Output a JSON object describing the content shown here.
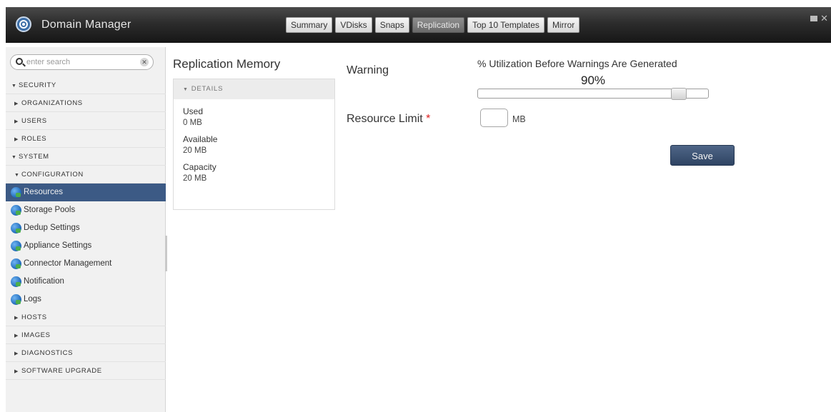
{
  "app": {
    "title": "Domain Manager",
    "tabs": [
      {
        "label": "Summary",
        "active": false
      },
      {
        "label": "VDisks",
        "active": false
      },
      {
        "label": "Snaps",
        "active": false
      },
      {
        "label": "Replication",
        "active": true
      },
      {
        "label": "Top 10 Templates",
        "active": false
      },
      {
        "label": "Mirror",
        "active": false
      }
    ],
    "window_controls": {
      "close": "✕"
    }
  },
  "sidebar": {
    "search": {
      "placeholder": "enter search",
      "value": ""
    },
    "nav": [
      {
        "type": "group",
        "label": "SECURITY",
        "expanded": true,
        "level": 0
      },
      {
        "type": "group",
        "label": "ORGANIZATIONS",
        "expanded": false,
        "level": 1
      },
      {
        "type": "group",
        "label": "USERS",
        "expanded": false,
        "level": 1
      },
      {
        "type": "group",
        "label": "ROLES",
        "expanded": false,
        "level": 1
      },
      {
        "type": "group",
        "label": "SYSTEM",
        "expanded": true,
        "level": 0
      },
      {
        "type": "group",
        "label": "CONFIGURATION",
        "expanded": true,
        "level": 1
      },
      {
        "type": "leaf",
        "label": "Resources",
        "active": true
      },
      {
        "type": "leaf",
        "label": "Storage Pools",
        "active": false
      },
      {
        "type": "leaf",
        "label": "Dedup Settings",
        "active": false
      },
      {
        "type": "leaf",
        "label": "Appliance Settings",
        "active": false
      },
      {
        "type": "leaf",
        "label": "Connector Management",
        "active": false
      },
      {
        "type": "leaf",
        "label": "Notification",
        "active": false
      },
      {
        "type": "leaf",
        "label": "Logs",
        "active": false
      },
      {
        "type": "group",
        "label": "HOSTS",
        "expanded": false,
        "level": 1
      },
      {
        "type": "group",
        "label": "IMAGES",
        "expanded": false,
        "level": 1
      },
      {
        "type": "group",
        "label": "DIAGNOSTICS",
        "expanded": false,
        "level": 1
      },
      {
        "type": "group",
        "label": "SOFTWARE UPGRADE",
        "expanded": false,
        "level": 1
      }
    ]
  },
  "main": {
    "section_title": "Replication Memory",
    "details": {
      "header": "DETAILS",
      "stats": [
        {
          "label": "Used",
          "value": "0 MB"
        },
        {
          "label": "Available",
          "value": "20 MB"
        },
        {
          "label": "Capacity",
          "value": "20 MB"
        }
      ]
    },
    "warning": {
      "label": "Warning",
      "util_label": "% Utilization Before Warnings Are Generated",
      "util_value": "90%",
      "slider_fraction": 0.9
    },
    "resource_limit": {
      "label": "Resource Limit",
      "required_mark": "*",
      "value": "",
      "unit": "MB"
    },
    "save_label": "Save"
  },
  "colors": {
    "titlebar": "#2c2c2c",
    "active_tab": "#6a6a6a",
    "sidebar_active": "#3c5a85",
    "save_button": "#3a5070",
    "required": "#d22222"
  }
}
